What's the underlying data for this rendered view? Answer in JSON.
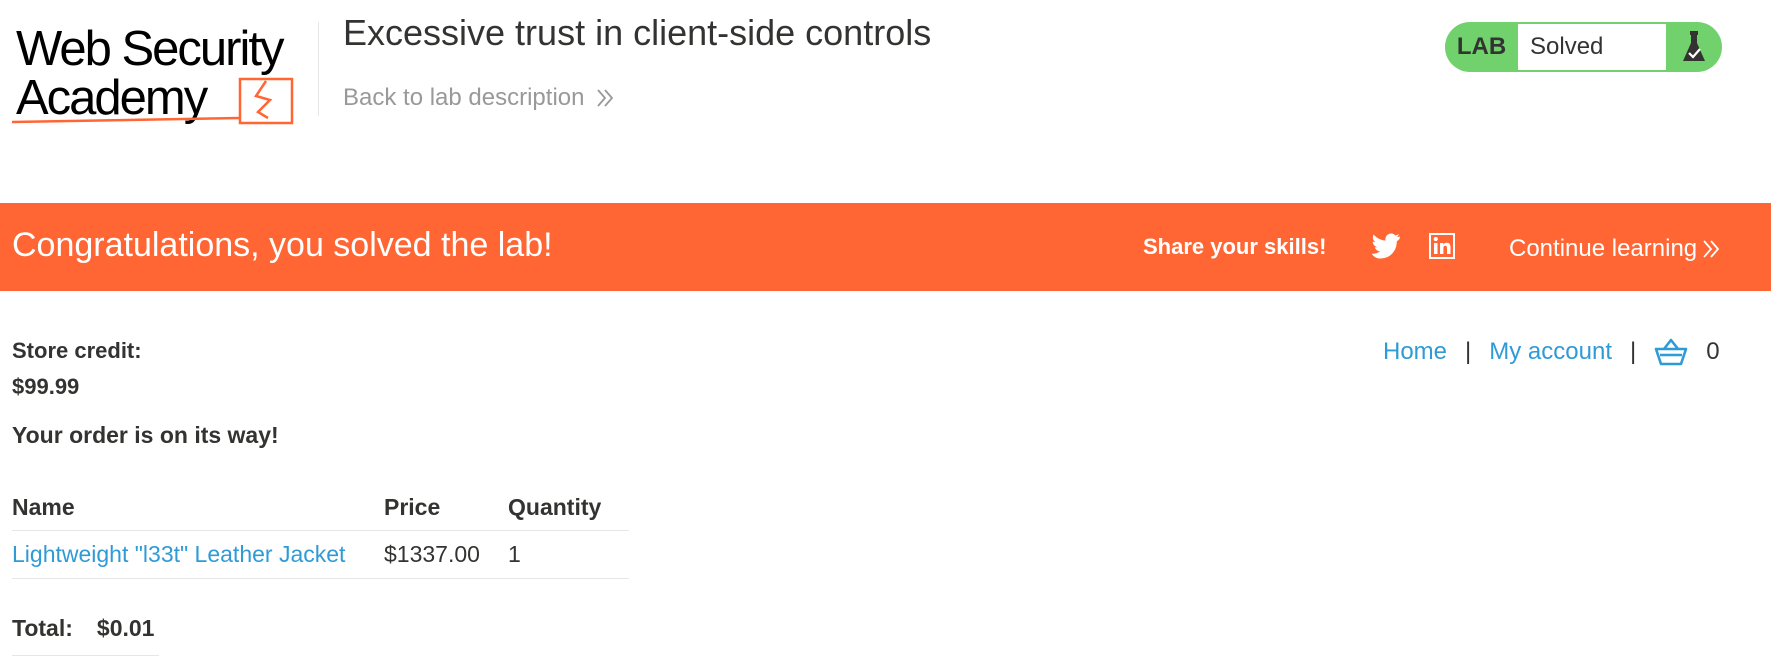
{
  "header": {
    "logo_line1": "Web Security",
    "logo_line2": "Academy",
    "lab_title": "Excessive trust in client-side controls",
    "back_link": "Back to lab description",
    "lab_badge": "LAB",
    "lab_status": "Solved"
  },
  "banner": {
    "message": "Congratulations, you solved the lab!",
    "share_label": "Share your skills!",
    "continue_label": "Continue learning"
  },
  "account": {
    "store_credit_label": "Store credit:",
    "store_credit_value": "$99.99",
    "order_message": "Your order is on its way!"
  },
  "nav": {
    "home": "Home",
    "separator": "|",
    "my_account": "My account",
    "cart_count": "0"
  },
  "order_table": {
    "headers": [
      "Name",
      "Price",
      "Quantity"
    ],
    "rows": [
      {
        "name": "Lightweight \"l33t\" Leather Jacket",
        "price": "$1337.00",
        "quantity": "1"
      }
    ]
  },
  "total": {
    "label": "Total:",
    "value": "$0.01"
  },
  "colors": {
    "accent_orange": "#ff6633",
    "status_green": "#70d16d",
    "link_blue": "#2f9bd6",
    "text_dark": "#333332"
  },
  "icons": [
    "flask-icon",
    "twitter-icon",
    "linkedin-icon",
    "chevron-right-icon",
    "basket-icon"
  ]
}
